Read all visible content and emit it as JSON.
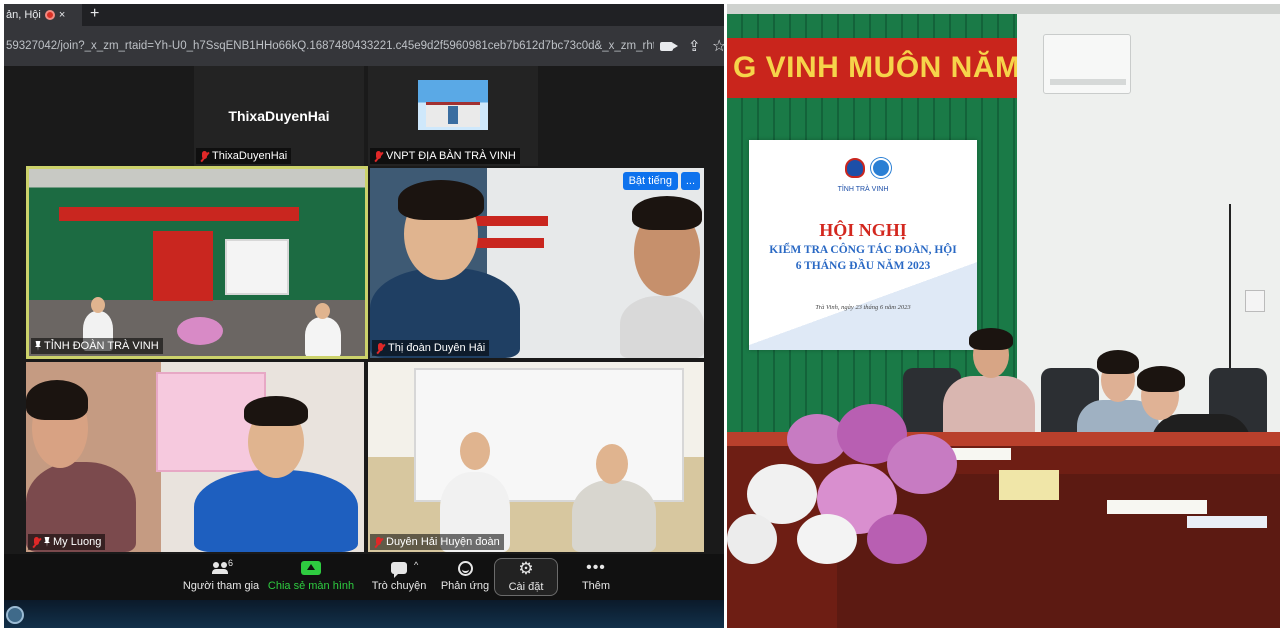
{
  "browser": {
    "tab_title": "ản, Hội",
    "tab_close": "×",
    "new_tab": "+",
    "url": "59327042/join?_x_zm_rtaid=Yh-U0_h7SsqENB1HHo66kQ.1687480433221.c45e9d2f5960981ceb7b612d7bc73c0d&_x_zm_rhtaid..."
  },
  "zoom": {
    "tiles_top": [
      {
        "display_name": "ThixaDuyenHai",
        "label": "ThixaDuyenHai"
      },
      {
        "display_name": "",
        "label": "VNPT ĐỊA BÀN TRÀ VINH"
      }
    ],
    "tiles_main": [
      {
        "label": "TỈNH ĐOÀN TRÀ VINH"
      },
      {
        "label": "Thị đoàn Duyên Hải"
      },
      {
        "label": "My Luong"
      },
      {
        "label": "Duyên Hải Huyện đoàn"
      }
    ],
    "unmute_button": "Bật tiếng",
    "more_button": "...",
    "toolbar": {
      "participants_label": "Người tham gia",
      "participants_count": "6",
      "share_label": "Chia sẻ màn hình",
      "chat_label": "Trò chuyện",
      "chat_caret": "^",
      "react_label": "Phản ứng",
      "settings_label": "Cài đặt",
      "more_label": "Thêm",
      "more_dots": "•••"
    },
    "colors": {
      "active_speaker_border": "#ccd26b",
      "share_green": "#2ecc40",
      "mute_red": "#e02828",
      "accent_blue": "#0e72ed"
    }
  },
  "room": {
    "wall_banner": "G VINH MUÔN NĂM",
    "screen": {
      "org": "TỈNH TRÀ VINH",
      "title": "HỘI NGHỊ",
      "subtitle_line1": "KIỂM TRA CÔNG TÁC ĐOÀN, HỘI",
      "subtitle_line2": "6 THÁNG ĐẦU NĂM 2023",
      "date": "Trà Vinh, ngày 23 tháng 6 năm 2023"
    }
  }
}
